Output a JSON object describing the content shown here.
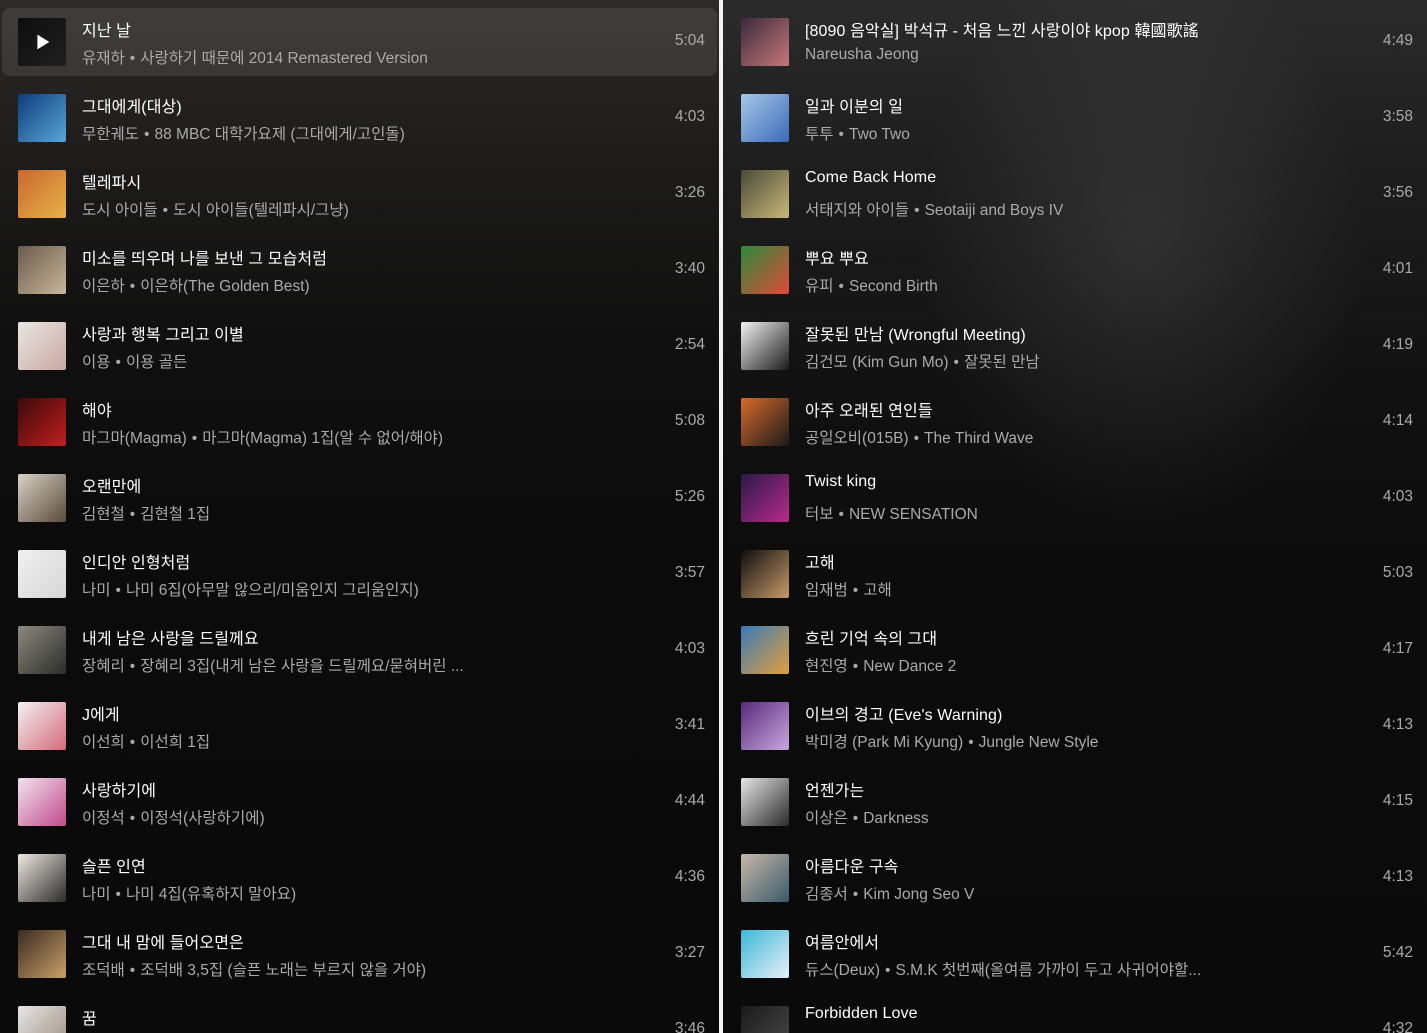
{
  "separator": "•",
  "left_column": [
    {
      "title": "지난 날",
      "artist": "유재하",
      "album": "사랑하기 때문에 2014 Remastered Version",
      "duration": "5:04",
      "active": true,
      "art": [
        "#1b1b1b",
        "#3a3a3a"
      ]
    },
    {
      "title": "그대에게(대상)",
      "artist": "무한궤도",
      "album": "88 MBC 대학가요제 (그대에게/고인돌)",
      "duration": "4:03",
      "art": [
        "#0e3c7a",
        "#59a6d8"
      ]
    },
    {
      "title": "텔레파시",
      "artist": "도시 아이들",
      "album": "도시 아이들(텔레파시/그냥)",
      "duration": "3:26",
      "art": [
        "#c9682c",
        "#e8b14a"
      ]
    },
    {
      "title": "미소를 띄우며 나를 보낸 그 모습처럼",
      "artist": "이은하",
      "album": "이은하(The Golden Best)",
      "duration": "3:40",
      "art": [
        "#6a5a4a",
        "#c8b79a"
      ]
    },
    {
      "title": "사랑과 행복 그리고 이별",
      "artist": "이용",
      "album": "이용 골든",
      "duration": "2:54",
      "art": [
        "#e8e6e2",
        "#c9a7a2"
      ]
    },
    {
      "title": "해야",
      "artist": "마그마(Magma)",
      "album": "마그마(Magma) 1집(알 수 없어/해야)",
      "duration": "5:08",
      "art": [
        "#3a0a0a",
        "#c21f1f"
      ]
    },
    {
      "title": "오랜만에",
      "artist": "김현철",
      "album": "김현철 1집",
      "duration": "5:26",
      "art": [
        "#d8d2c6",
        "#5a4a3a"
      ]
    },
    {
      "title": "인디안 인형처럼",
      "artist": "나미",
      "album": "나미 6집(아무말 않으리/미움인지 그리움인지)",
      "duration": "3:57",
      "art": [
        "#f0f0f0",
        "#d6d6d6"
      ]
    },
    {
      "title": "내게 남은 사랑을 드릴께요",
      "artist": "장혜리",
      "album": "장혜리 3집(내게 남은 사랑을 드릴께요/묻혀버린 ...",
      "duration": "4:03",
      "art": [
        "#8a8a80",
        "#2c2c28"
      ]
    },
    {
      "title": "J에게",
      "artist": "이선희",
      "album": "이선희 1집",
      "duration": "3:41",
      "art": [
        "#f2f2f2",
        "#d46a7a"
      ]
    },
    {
      "title": "사랑하기에",
      "artist": "이정석",
      "album": "이정석(사랑하기에)",
      "duration": "4:44",
      "art": [
        "#f1e4ee",
        "#c14a8c"
      ]
    },
    {
      "title": "슬픈 인연",
      "artist": "나미",
      "album": "나미 4집(유혹하지 말아요)",
      "duration": "4:36",
      "art": [
        "#efe9e2",
        "#2a2a2a"
      ]
    },
    {
      "title": "그대 내 맘에 들어오면은",
      "artist": "조덕배",
      "album": "조덕배 3,5집 (슬픈 노래는 부르지 않을 거야)",
      "duration": "3:27",
      "art": [
        "#3a2a1e",
        "#c9a06a"
      ]
    },
    {
      "title": "꿈",
      "artist": "",
      "album": "",
      "duration": "3:46",
      "art": [
        "#e6e6e6",
        "#9a8a7a"
      ]
    }
  ],
  "right_column": [
    {
      "title": "[8090 음악실] 박석규 - 처음 느낀 사랑이야 kpop 韓國歌謠",
      "artist": "Nareusha Jeong",
      "album": "",
      "duration": "4:49",
      "art": [
        "#3a2a3a",
        "#c8787a"
      ]
    },
    {
      "title": "일과 이분의 일",
      "artist": "투투",
      "album": "Two Two",
      "duration": "3:58",
      "art": [
        "#a8c8e8",
        "#3a6ab8"
      ]
    },
    {
      "title": "Come Back Home",
      "artist": "서태지와 아이들",
      "album": "Seotaiji and Boys IV",
      "duration": "3:56",
      "art": [
        "#4a4a3a",
        "#c8b878"
      ]
    },
    {
      "title": "뿌요 뿌요",
      "artist": "유피",
      "album": "Second Birth",
      "duration": "4:01",
      "art": [
        "#2a8a3a",
        "#e04a3a"
      ]
    },
    {
      "title": "잘못된 만남 (Wrongful Meeting)",
      "artist": "김건모 (Kim Gun Mo)",
      "album": "잘못된 만남",
      "duration": "4:19",
      "art": [
        "#f2f2f2",
        "#1a1a1a"
      ]
    },
    {
      "title": "아주 오래된 연인들",
      "artist": "공일오비(015B)",
      "album": "The Third Wave",
      "duration": "4:14",
      "art": [
        "#d86a2a",
        "#1a1a1a"
      ]
    },
    {
      "title": "Twist king",
      "artist": "터보",
      "album": "NEW SENSATION",
      "duration": "4:03",
      "art": [
        "#2a1a4a",
        "#b82a8a"
      ]
    },
    {
      "title": "고해",
      "artist": "임재범",
      "album": "고해",
      "duration": "5:03",
      "art": [
        "#0e0e0e",
        "#c89a6a"
      ]
    },
    {
      "title": "흐린 기억 속의 그대",
      "artist": "현진영",
      "album": "New Dance 2",
      "duration": "4:17",
      "art": [
        "#3a7ab8",
        "#e0a03a"
      ]
    },
    {
      "title": "이브의 경고 (Eve's Warning)",
      "artist": "박미경 (Park Mi Kyung)",
      "album": "Jungle New Style",
      "duration": "4:13",
      "art": [
        "#5a2a7a",
        "#c8a8e0"
      ]
    },
    {
      "title": "언젠가는",
      "artist": "이상은",
      "album": "Darkness",
      "duration": "4:15",
      "art": [
        "#e6e6e6",
        "#2a2a2a"
      ]
    },
    {
      "title": "아름다운 구속",
      "artist": "김종서",
      "album": "Kim Jong Seo  V",
      "duration": "4:13",
      "art": [
        "#c8b8a8",
        "#3a5a6a"
      ]
    },
    {
      "title": "여름안에서",
      "artist": "듀스(Deux)",
      "album": "S.M.K 첫번째(올여름 가까이 두고 사귀어야할...",
      "duration": "5:42",
      "art": [
        "#3ab8d8",
        "#e8f0f8"
      ]
    },
    {
      "title": "Forbidden Love",
      "artist": "",
      "album": "",
      "duration": "4:32",
      "art": [
        "#1a1a1a",
        "#4a4a4a"
      ]
    }
  ]
}
